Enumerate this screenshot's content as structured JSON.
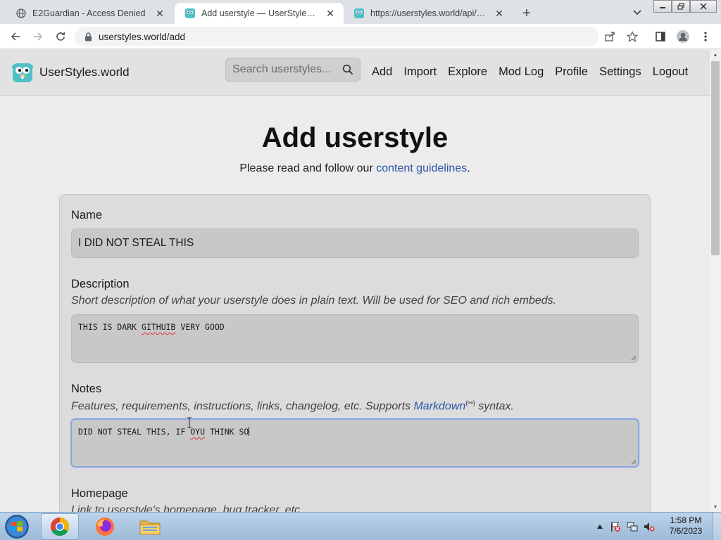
{
  "browser": {
    "tabs": [
      {
        "title": "E2Guardian - Access Denied",
        "active": false
      },
      {
        "title": "Add userstyle — UserStyles.world",
        "active": true
      },
      {
        "title": "https://userstyles.world/api/style/",
        "active": false
      }
    ],
    "url": "userstyles.world/add"
  },
  "header": {
    "brand": "UserStyles.world",
    "search_placeholder": "Search userstyles...",
    "nav": [
      "Add",
      "Import",
      "Explore",
      "Mod Log",
      "Profile",
      "Settings",
      "Logout"
    ]
  },
  "page": {
    "title": "Add userstyle",
    "subtitle_prefix": "Please read and follow our ",
    "subtitle_link": "content guidelines",
    "subtitle_suffix": "."
  },
  "form": {
    "name_label": "Name",
    "name_value": "I DID NOT STEAL THIS",
    "description_label": "Description",
    "description_hint": "Short description of what your userstyle does in plain text. Will be used for SEO and rich embeds.",
    "description_value": {
      "pre": "THIS IS DARK ",
      "typo": "GITHUIB",
      "post": " VERY GOOD"
    },
    "notes_label": "Notes",
    "notes_hint_prefix": "Features, requirements, instructions, links, changelog, etc. Supports ",
    "notes_hint_link": "Markdown",
    "notes_hint_sup": "(⚯)",
    "notes_hint_suffix": " syntax.",
    "notes_value": {
      "pre": "DID NOT STEAL THIS, IF ",
      "typo": "OYU",
      "post": " THINK SO"
    },
    "homepage_label": "Homepage",
    "homepage_hint": "Link to userstyle's homepage, bug tracker, etc."
  },
  "taskbar": {
    "time": "1:58 PM",
    "date": "7/6/2023"
  },
  "colors": {
    "link": "#2c55a8",
    "focus_ring": "#8ea6d8",
    "card": "#dcdcdc",
    "input": "#c8c8c8"
  }
}
